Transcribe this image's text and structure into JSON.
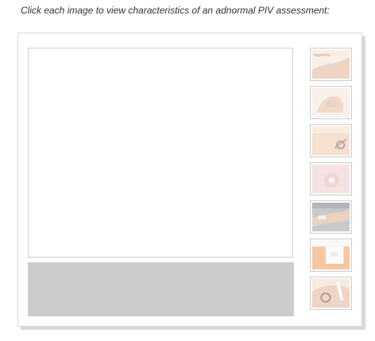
{
  "instruction": "Click each image to view characteristics of an adnormal PIV assessment:",
  "caption": "",
  "thumbnails": [
    {
      "name": "thumb-infiltration-arm",
      "icon": "photo-icon"
    },
    {
      "name": "thumb-swollen-hand",
      "icon": "photo-icon"
    },
    {
      "name": "thumb-iv-site-wrist",
      "icon": "photo-icon"
    },
    {
      "name": "thumb-pustule-skin",
      "icon": "photo-icon"
    },
    {
      "name": "thumb-arm-iv-line",
      "icon": "photo-icon"
    },
    {
      "name": "thumb-iv-dressing",
      "icon": "photo-icon"
    },
    {
      "name": "thumb-iv-cannula-hand",
      "icon": "photo-icon"
    }
  ],
  "colors": {
    "caption_bg": "#cccccc",
    "frame_border": "#d6d6d6",
    "skin": "#e8b48a"
  }
}
